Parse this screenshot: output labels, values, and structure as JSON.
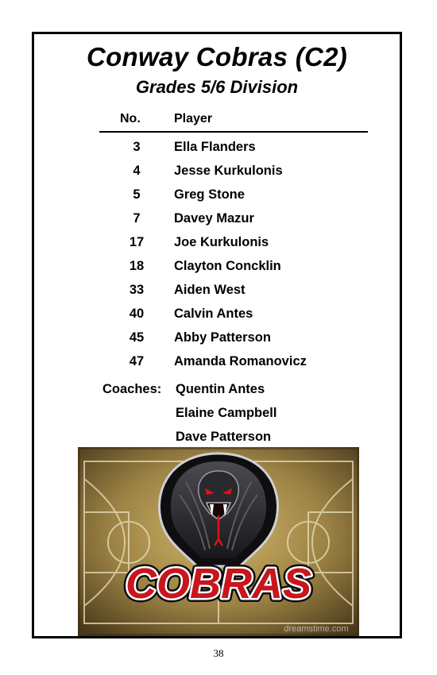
{
  "header": {
    "title": "Conway Cobras (C2)",
    "subtitle": "Grades 5/6 Division"
  },
  "table": {
    "columns": [
      "No.",
      "Player"
    ],
    "rows": [
      {
        "number": "3",
        "player": "Ella Flanders"
      },
      {
        "number": "4",
        "player": "Jesse Kurkulonis"
      },
      {
        "number": "5",
        "player": "Greg Stone"
      },
      {
        "number": "7",
        "player": "Davey Mazur"
      },
      {
        "number": "17",
        "player": "Joe Kurkulonis"
      },
      {
        "number": "18",
        "player": "Clayton Concklin"
      },
      {
        "number": "33",
        "player": "Aiden West"
      },
      {
        "number": "40",
        "player": "Calvin Antes"
      },
      {
        "number": "45",
        "player": "Abby Patterson"
      },
      {
        "number": "47",
        "player": "Amanda Romanovicz"
      }
    ]
  },
  "coaches": {
    "label": "Coaches:",
    "names": [
      "Quentin Antes",
      "Elaine Campbell",
      "Dave Patterson"
    ]
  },
  "logo": {
    "text": "COBRAS",
    "watermark": "dreamstime.com",
    "icon": "cobra-icon",
    "colors": {
      "background": "#8a7440",
      "text_fill": "#c8161d",
      "text_outline": "#ffffff",
      "snake_body": "#2a2a2e",
      "eyes": "#e0121a"
    }
  },
  "footer": {
    "page_number": "38"
  }
}
